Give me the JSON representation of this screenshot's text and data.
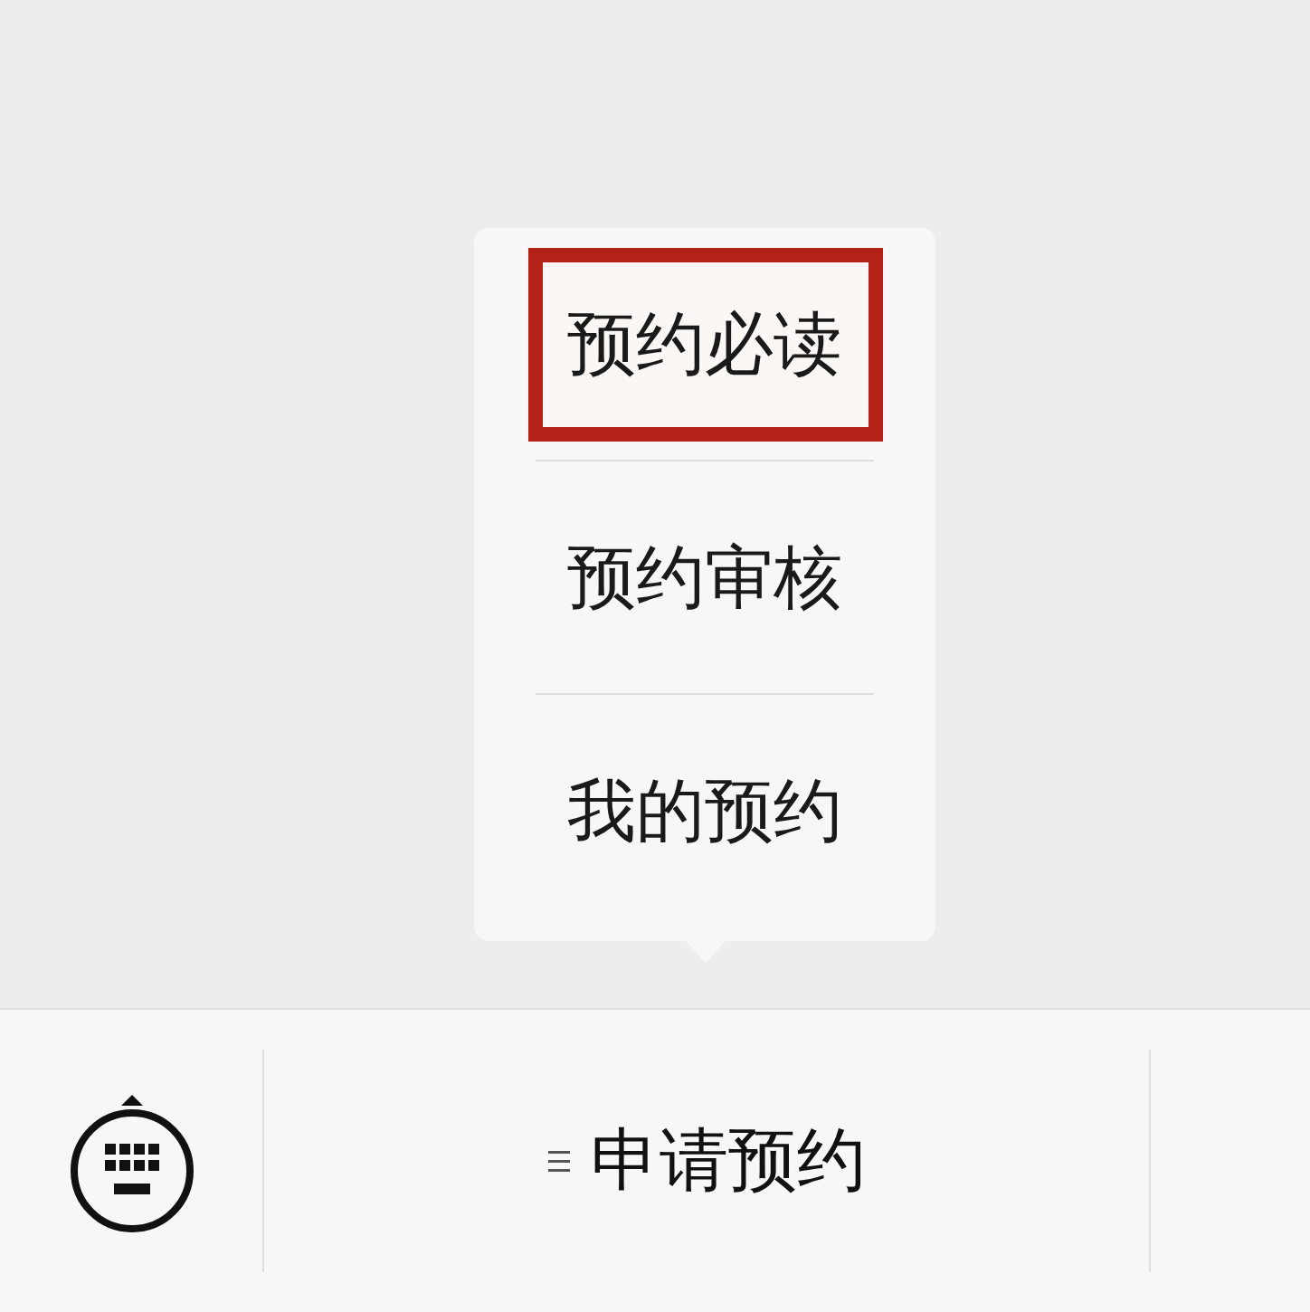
{
  "popup_menu": {
    "items": [
      {
        "label": "预约必读",
        "highlighted": true
      },
      {
        "label": "预约审核",
        "highlighted": false
      },
      {
        "label": "我的预约",
        "highlighted": false
      }
    ]
  },
  "menu_bar": {
    "items": [
      {
        "label": "申请预约",
        "has_submenu": true
      }
    ]
  }
}
